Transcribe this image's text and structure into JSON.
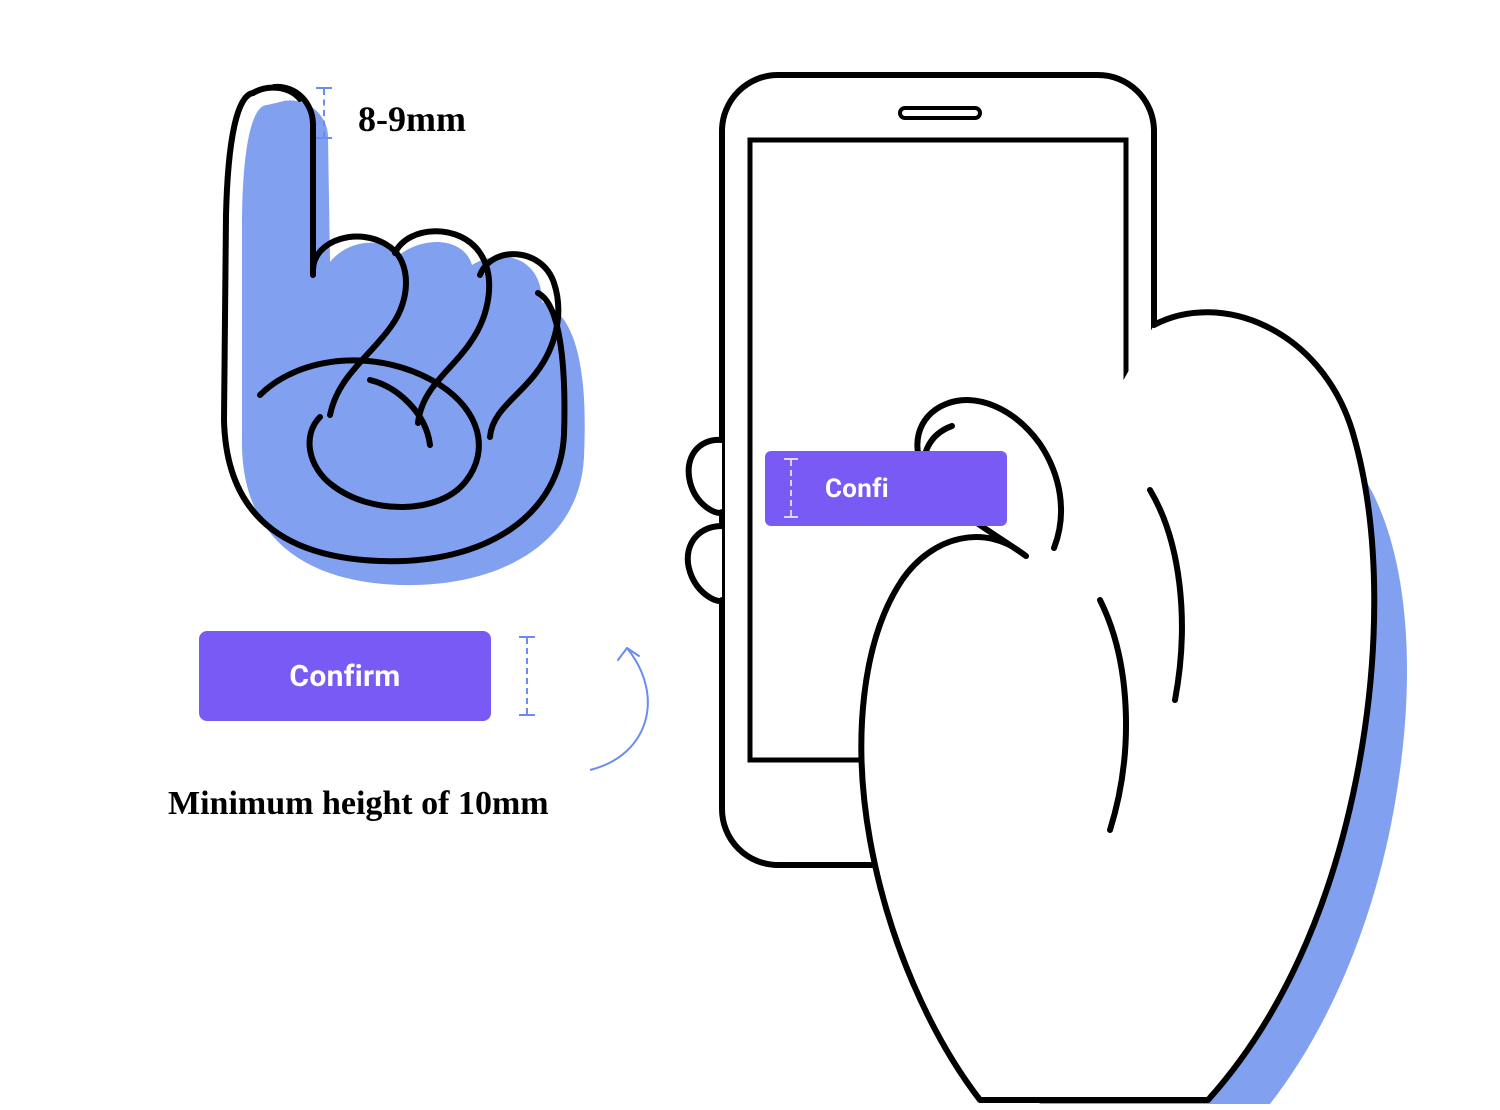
{
  "fingertip": {
    "label": "8-9mm"
  },
  "button": {
    "label": "Confirm"
  },
  "min_height": {
    "label": "Minimum height of 10mm"
  },
  "phone_button": {
    "label": "Confi"
  },
  "colors": {
    "accent": "#7a5af5",
    "hand_fill": "#82a0f0",
    "guide": "#6b8cf0"
  }
}
